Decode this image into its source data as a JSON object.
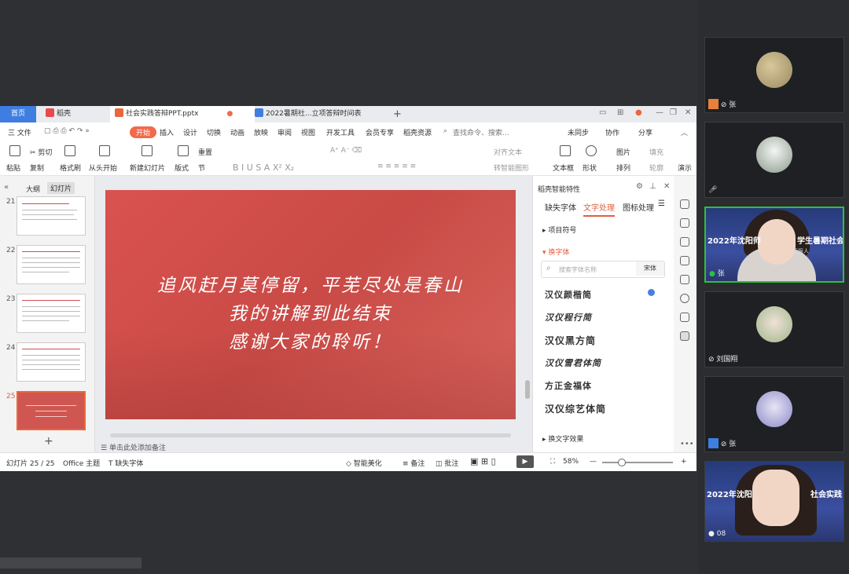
{
  "tabs": {
    "home": "首页",
    "docer": "稻壳",
    "ppt_file": "社会实践答辩PPT.pptx",
    "doc2_file": "2022暑期社...立项答辩时间表",
    "add": "+"
  },
  "menu": {
    "file": "三 文件",
    "start": "开始",
    "insert": "插入",
    "design": "设计",
    "transition": "切换",
    "animation": "动画",
    "slideshow": "放映",
    "review": "审阅",
    "view": "视图",
    "devtools": "开发工具",
    "member": "会员专享",
    "docer_res": "稻壳资源",
    "search_placeholder": "查找命令、搜索...",
    "unsync": "未同步",
    "collab": "协作",
    "share": "分享"
  },
  "ribbon": {
    "paste": "粘贴",
    "cut": "剪切",
    "copy": "复制",
    "format_brush": "格式刷",
    "from_start": "从头开始",
    "new_slide": "新建幻灯片",
    "layout": "版式",
    "section": "节",
    "reset": "重置",
    "align_text": "对齐文本",
    "smart_shape": "转智能图形",
    "textbox": "文本框",
    "shape": "形状",
    "arrange": "排列",
    "picture": "图片",
    "fill": "填充",
    "outline": "轮廓",
    "present": "演示"
  },
  "thumbs": {
    "tab_outline": "大纲",
    "tab_slides": "幻灯片",
    "numbers": [
      "21",
      "22",
      "23",
      "24",
      "25"
    ],
    "add": "+"
  },
  "slide": {
    "line1": "追风赶月莫停留，平芜尽处是春山",
    "line2": "我的讲解到此结束",
    "line3": "感谢大家的聆听！"
  },
  "panel": {
    "title": "稻壳智能特性",
    "tab_missing_font": "缺失字体",
    "tab_text": "文字处理",
    "tab_icon": "图标处理",
    "bullet": "项目符号",
    "change_font": "换字体",
    "search_placeholder": "搜索字体名称",
    "current_font": "宋体",
    "fonts": [
      "汉仪颜楷简",
      "汉仪程行简",
      "汉仪黑方简",
      "汉仪雪君体简",
      "方正金福体",
      "汉仪综艺体简"
    ],
    "text_effect": "换文字效果"
  },
  "notes": {
    "placeholder": "单击此处添加备注"
  },
  "status": {
    "slide_count": "幻灯片 25 / 25",
    "theme": "Office 主题",
    "missing_font": "缺失字体",
    "beautify": "智能美化",
    "notes": "备注",
    "comment": "批注",
    "zoom": "58%"
  },
  "video": {
    "tiles": [
      {
        "name": "张"
      },
      {
        "name": ""
      },
      {
        "name": "张",
        "banner": "2022年沈阳师",
        "banner_right": "学生暑期社会实践",
        "sub": "汇报人"
      },
      {
        "name": "刘国翔"
      },
      {
        "name": "张"
      },
      {
        "name": "08",
        "banner": "2022年沈阳",
        "banner_right": "社会实践"
      }
    ]
  },
  "colors": {
    "accent": "#3f7ee0",
    "start": "#f26a4a",
    "slide_red": "#d9534f",
    "active_border": "#2fbf3f"
  }
}
